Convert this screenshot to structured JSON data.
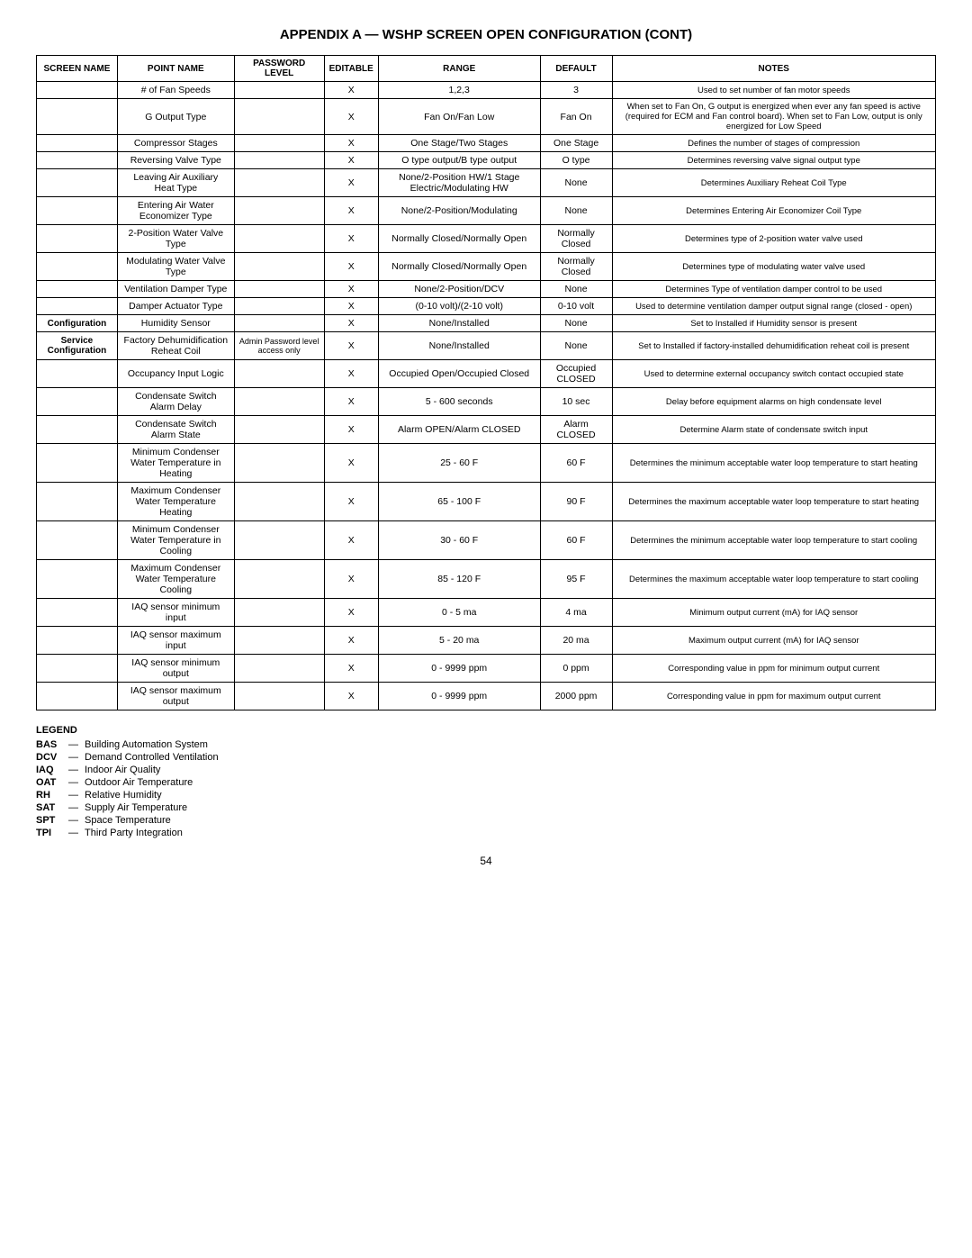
{
  "title": "APPENDIX A — WSHP SCREEN OPEN CONFIGURATION (cont)",
  "table": {
    "headers": [
      "SCREEN NAME",
      "POINT NAME",
      "PASSWORD LEVEL",
      "EDITABLE",
      "RANGE",
      "DEFAULT",
      "NOTES"
    ],
    "rows": [
      {
        "screen_name": "",
        "point_name": "# of Fan Speeds",
        "password": "",
        "editable": "X",
        "range": "1,2,3",
        "default": "3",
        "notes": "Used to set number of fan motor speeds"
      },
      {
        "screen_name": "",
        "point_name": "G Output Type",
        "password": "",
        "editable": "X",
        "range": "Fan On/Fan Low",
        "default": "Fan On",
        "notes": "When set to Fan On, G output is energized when ever any fan speed is active (required for ECM and Fan control board). When set to Fan Low, output is only energized for Low Speed"
      },
      {
        "screen_name": "",
        "point_name": "Compressor Stages",
        "password": "",
        "editable": "X",
        "range": "One Stage/Two Stages",
        "default": "One Stage",
        "notes": "Defines the number of stages of compression"
      },
      {
        "screen_name": "",
        "point_name": "Reversing Valve Type",
        "password": "",
        "editable": "X",
        "range": "O type output/B type output",
        "default": "O type",
        "notes": "Determines reversing valve signal output type"
      },
      {
        "screen_name": "",
        "point_name": "Leaving Air Auxiliary Heat Type",
        "password": "",
        "editable": "X",
        "range": "None/2-Position HW/1 Stage Electric/Modulating HW",
        "default": "None",
        "notes": "Determines Auxiliary Reheat Coil Type"
      },
      {
        "screen_name": "",
        "point_name": "Entering Air Water Economizer Type",
        "password": "",
        "editable": "X",
        "range": "None/2-Position/Modulating",
        "default": "None",
        "notes": "Determines Entering Air Economizer Coil Type"
      },
      {
        "screen_name": "",
        "point_name": "2-Position Water Valve Type",
        "password": "",
        "editable": "X",
        "range": "Normally Closed/Normally Open",
        "default": "Normally Closed",
        "notes": "Determines type of 2-position water valve used"
      },
      {
        "screen_name": "",
        "point_name": "Modulating Water Valve Type",
        "password": "",
        "editable": "X",
        "range": "Normally Closed/Normally Open",
        "default": "Normally Closed",
        "notes": "Determines type of modulating water valve used"
      },
      {
        "screen_name": "",
        "point_name": "Ventilation Damper Type",
        "password": "",
        "editable": "X",
        "range": "None/2-Position/DCV",
        "default": "None",
        "notes": "Determines Type of ventilation damper control to be used"
      },
      {
        "screen_name": "",
        "point_name": "Damper Actuator Type",
        "password": "",
        "editable": "X",
        "range": "(0-10 volt)/(2-10 volt)",
        "default": "0-10 volt",
        "notes": "Used to determine ventilation damper output signal range (closed - open)"
      },
      {
        "screen_name": "Configuration",
        "point_name": "Humidity Sensor",
        "password": "",
        "editable": "X",
        "range": "None/Installed",
        "default": "None",
        "notes": "Set to Installed if Humidity sensor is present"
      },
      {
        "screen_name": "Service Configuration",
        "point_name": "Factory Dehumidification Reheat Coil",
        "password": "Admin Password level access only",
        "editable": "X",
        "range": "None/Installed",
        "default": "None",
        "notes": "Set to Installed if factory-installed dehumidification reheat coil is present"
      },
      {
        "screen_name": "",
        "point_name": "Occupancy Input Logic",
        "password": "",
        "editable": "X",
        "range": "Occupied Open/Occupied Closed",
        "default": "Occupied CLOSED",
        "notes": "Used to determine external occupancy switch contact occupied state"
      },
      {
        "screen_name": "",
        "point_name": "Condensate Switch Alarm Delay",
        "password": "",
        "editable": "X",
        "range": "5 - 600 seconds",
        "default": "10 sec",
        "notes": "Delay before equipment alarms on high condensate level"
      },
      {
        "screen_name": "",
        "point_name": "Condensate Switch Alarm State",
        "password": "",
        "editable": "X",
        "range": "Alarm OPEN/Alarm CLOSED",
        "default": "Alarm CLOSED",
        "notes": "Determine Alarm state of condensate switch input"
      },
      {
        "screen_name": "",
        "point_name": "Minimum Condenser Water Temperature in Heating",
        "password": "",
        "editable": "X",
        "range": "25 - 60  F",
        "default": "60  F",
        "notes": "Determines the minimum acceptable water loop temperature to start heating"
      },
      {
        "screen_name": "",
        "point_name": "Maximum Condenser Water Temperature Heating",
        "password": "",
        "editable": "X",
        "range": "65 - 100  F",
        "default": "90  F",
        "notes": "Determines the maximum acceptable water loop temperature to start heating"
      },
      {
        "screen_name": "",
        "point_name": "Minimum Condenser Water Temperature in Cooling",
        "password": "",
        "editable": "X",
        "range": "30 - 60  F",
        "default": "60  F",
        "notes": "Determines the minimum acceptable water loop temperature to start cooling"
      },
      {
        "screen_name": "",
        "point_name": "Maximum Condenser Water Temperature Cooling",
        "password": "",
        "editable": "X",
        "range": "85 - 120  F",
        "default": "95  F",
        "notes": "Determines the maximum acceptable water loop temperature to start cooling"
      },
      {
        "screen_name": "",
        "point_name": "IAQ sensor minimum input",
        "password": "",
        "editable": "X",
        "range": "0 - 5 ma",
        "default": "4 ma",
        "notes": "Minimum output current (mA) for IAQ sensor"
      },
      {
        "screen_name": "",
        "point_name": "IAQ sensor maximum input",
        "password": "",
        "editable": "X",
        "range": "5 - 20 ma",
        "default": "20 ma",
        "notes": "Maximum output current (mA) for IAQ sensor"
      },
      {
        "screen_name": "",
        "point_name": "IAQ sensor minimum output",
        "password": "",
        "editable": "X",
        "range": "0 - 9999 ppm",
        "default": "0 ppm",
        "notes": "Corresponding value in ppm for minimum output current"
      },
      {
        "screen_name": "",
        "point_name": "IAQ sensor maximum output",
        "password": "",
        "editable": "X",
        "range": "0 - 9999 ppm",
        "default": "2000 ppm",
        "notes": "Corresponding value in ppm for maximum output current"
      }
    ]
  },
  "legend": {
    "title": "LEGEND",
    "items": [
      {
        "key": "BAS",
        "description": "Building Automation System"
      },
      {
        "key": "DCV",
        "description": "Demand Controlled Ventilation"
      },
      {
        "key": "IAQ",
        "description": "Indoor Air Quality"
      },
      {
        "key": "OAT",
        "description": "Outdoor Air Temperature"
      },
      {
        "key": "RH",
        "description": "Relative Humidity"
      },
      {
        "key": "SAT",
        "description": "Supply Air Temperature"
      },
      {
        "key": "SPT",
        "description": "Space Temperature"
      },
      {
        "key": "TPI",
        "description": "Third Party Integration"
      }
    ]
  },
  "page_number": "54"
}
